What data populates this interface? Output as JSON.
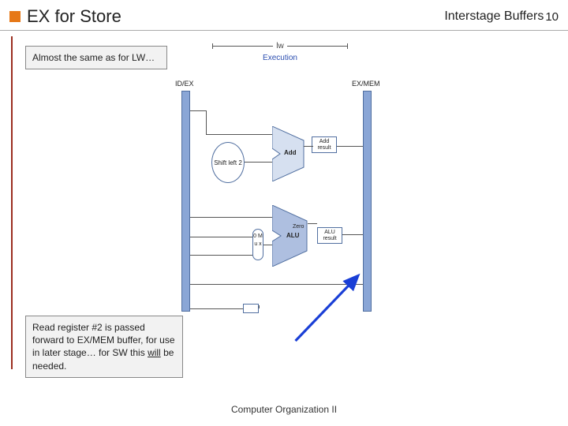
{
  "header": {
    "title": "EX for Store",
    "subtitle": "Interstage Buffers",
    "slide_number": "10"
  },
  "notes": {
    "top": "Almost the same as for LW…",
    "bottom_a": "Read register #2 is passed forward to EX/MEM buffer, for use in later stage… for SW this ",
    "bottom_will": "will",
    "bottom_b": " be needed."
  },
  "diagram": {
    "stage_top_small": "lw",
    "stage_name": "Execution",
    "buffer_left": "ID/EX",
    "buffer_right": "EX/MEM",
    "shift_label": "Shift left 2",
    "adder_label": "Add",
    "adder_result": "Add result",
    "alu_zero": "Zero",
    "alu_label": "ALU",
    "alu_result": "ALU result",
    "mux_label": "0 M u x"
  },
  "footer": "Computer Organization II"
}
